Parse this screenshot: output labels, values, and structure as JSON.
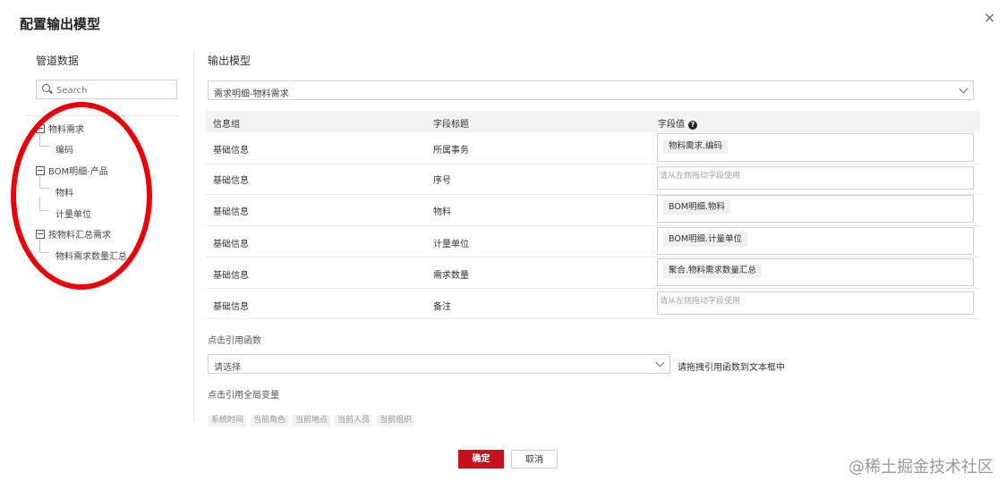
{
  "dialog": {
    "title": "配置输出模型",
    "close_symbol": "×"
  },
  "left": {
    "title": "管道数据",
    "search_placeholder": "Search",
    "tree": [
      {
        "label": "物料需求",
        "children": [
          "编码"
        ]
      },
      {
        "label": "BOM明细-产品",
        "children": [
          "物料",
          "计量单位"
        ]
      },
      {
        "label": "按物料汇总需求",
        "children": [
          "物料需求数量汇总"
        ]
      }
    ]
  },
  "right": {
    "title": "输出模型",
    "model_select_value": "需求明细-物料需求",
    "table": {
      "headers": [
        "信息组",
        "字段标题",
        "字段值"
      ],
      "rows": [
        {
          "group": "基础信息",
          "field": "所属事务",
          "value": "物料需求.编码",
          "placeholder": ""
        },
        {
          "group": "基础信息",
          "field": "序号",
          "value": "",
          "placeholder": "请从左侧拖动字段使用"
        },
        {
          "group": "基础信息",
          "field": "物料",
          "value": "BOM明细.物料",
          "placeholder": ""
        },
        {
          "group": "基础信息",
          "field": "计量单位",
          "value": "BOM明细.计量单位",
          "placeholder": ""
        },
        {
          "group": "基础信息",
          "field": "需求数量",
          "value": "聚合.物料需求数量汇总",
          "placeholder": ""
        },
        {
          "group": "基础信息",
          "field": "备注",
          "value": "",
          "placeholder": "请从左侧拖动字段使用"
        }
      ]
    },
    "function_label": "点击引用函数",
    "function_select_placeholder": "请选择",
    "function_hint": "请拖拽引用函数到文本框中",
    "globals_label": "点击引用全局变量",
    "globals": [
      "系统时间",
      "当前角色",
      "当前地点",
      "当前人员",
      "当前组织"
    ]
  },
  "footer": {
    "ok_label": "确定",
    "cancel_label": "取消"
  },
  "watermark": "@稀土掘金技术社区",
  "colors": {
    "primary": "#c8101d",
    "annotation": "#e8000a"
  }
}
